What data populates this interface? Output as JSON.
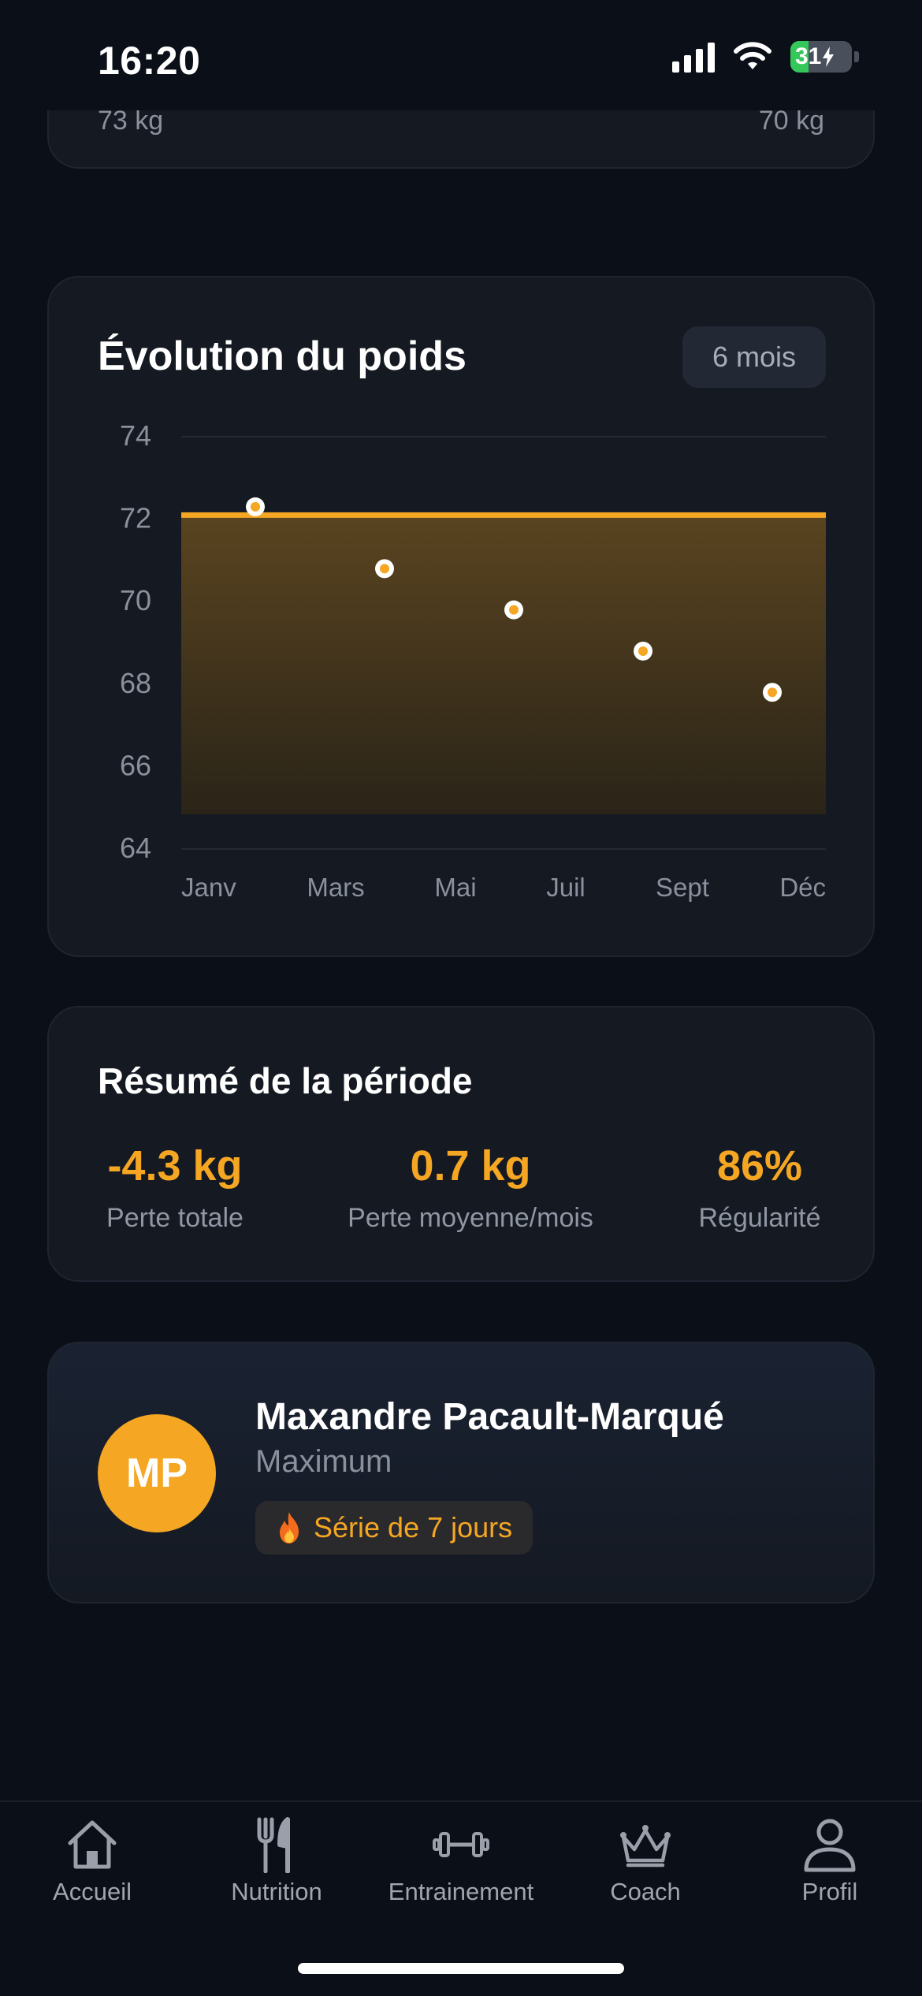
{
  "status_bar": {
    "time": "16:20",
    "battery": "31"
  },
  "previous_card": {
    "left_value": "73 kg",
    "right_value": "70 kg"
  },
  "weight_chart": {
    "title": "Évolution du poids",
    "period": "6 mois"
  },
  "chart_data": {
    "type": "line",
    "title": "Évolution du poids",
    "x_tick_labels": [
      "Janv",
      "Mars",
      "Mai",
      "Juil",
      "Sept",
      "Déc"
    ],
    "y_tick_labels": [
      "74",
      "72",
      "70",
      "68",
      "66",
      "64"
    ],
    "ylim": [
      64,
      74
    ],
    "ytick_step": 2,
    "points": [
      {
        "x": "Févr",
        "y": 72.3
      },
      {
        "x": "Avr",
        "y": 70.8
      },
      {
        "x": "Juin",
        "y": 69.8
      },
      {
        "x": "Août",
        "y": 68.8
      },
      {
        "x": "Oct",
        "y": 67.8
      }
    ],
    "reference_line": 72.1,
    "grid": true,
    "accent_color": "#f5a623"
  },
  "summary": {
    "title": "Résumé de la période",
    "stats": [
      {
        "value": "-4.3 kg",
        "label": "Perte totale"
      },
      {
        "value": "0.7 kg",
        "label": "Perte moyenne/mois"
      },
      {
        "value": "86%",
        "label": "Régularité"
      }
    ]
  },
  "profile": {
    "initials": "MP",
    "name": "Maxandre Pacault-Marqué",
    "plan": "Maximum",
    "streak": "Série de 7 jours",
    "streak_icon": "flame-icon"
  },
  "tabs": [
    {
      "label": "Accueil",
      "icon": "home-icon"
    },
    {
      "label": "Nutrition",
      "icon": "fork-knife-icon"
    },
    {
      "label": "Entrainement",
      "icon": "dumbbell-icon"
    },
    {
      "label": "Coach",
      "icon": "crown-icon"
    },
    {
      "label": "Profil",
      "icon": "person-icon"
    }
  ],
  "colors": {
    "accent": "#f5a623",
    "background": "#0b0f18",
    "card": "#141922"
  }
}
